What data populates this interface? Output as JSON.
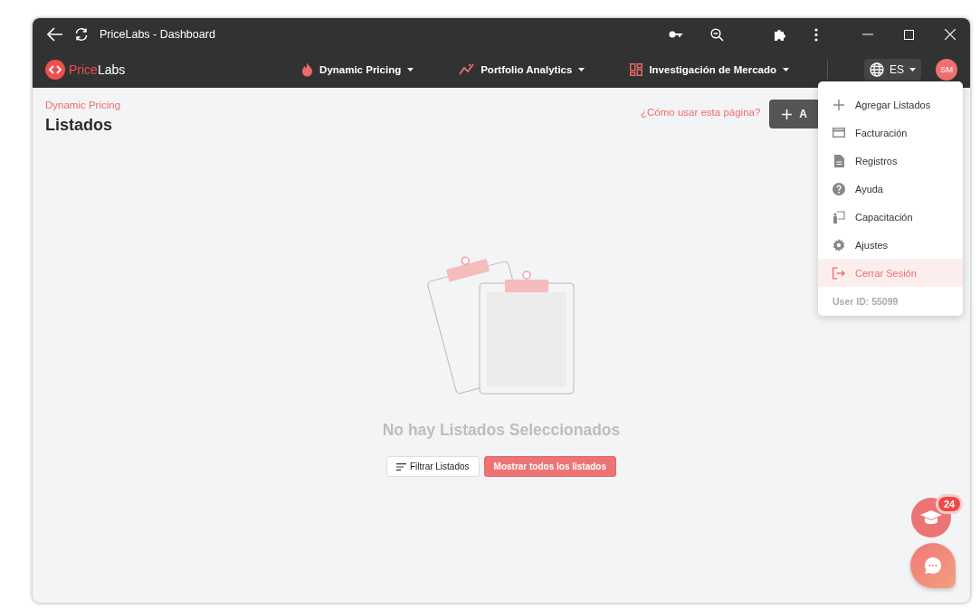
{
  "window": {
    "title": "PriceLabs - Dashboard"
  },
  "brand": {
    "part_1": "Price",
    "part_2": "Labs"
  },
  "nav": [
    {
      "label": "Dynamic Pricing",
      "kind": "flame"
    },
    {
      "label": "Portfolio Analytics",
      "kind": "trend"
    },
    {
      "label": "Investigación de Mercado",
      "kind": "grid"
    }
  ],
  "language": "ES",
  "avatar": "SM",
  "breadcrumb": "Dynamic Pricing",
  "page_title": "Listados",
  "help_link": "¿Cómo usar esta página?",
  "add_button": "A",
  "menu": {
    "items": [
      {
        "label": "Agregar Listados",
        "kind": "plus",
        "selected": false
      },
      {
        "label": "Facturación",
        "kind": "card",
        "selected": false
      },
      {
        "label": "Registros",
        "kind": "doc",
        "selected": false
      },
      {
        "label": "Ayuda",
        "kind": "help",
        "selected": false
      },
      {
        "label": "Capacitación",
        "kind": "teach",
        "selected": false
      },
      {
        "label": "Ajustes",
        "kind": "gear",
        "selected": false
      },
      {
        "label": "Cerrar Sesión",
        "kind": "logout",
        "selected": true
      }
    ],
    "user_id": "User ID: 55099"
  },
  "empty": {
    "message": "No hay Listados Seleccionados",
    "filter_button": "Filtrar Listados",
    "show_all_button": "Mostrar todos los listados"
  },
  "training_badge": "24"
}
